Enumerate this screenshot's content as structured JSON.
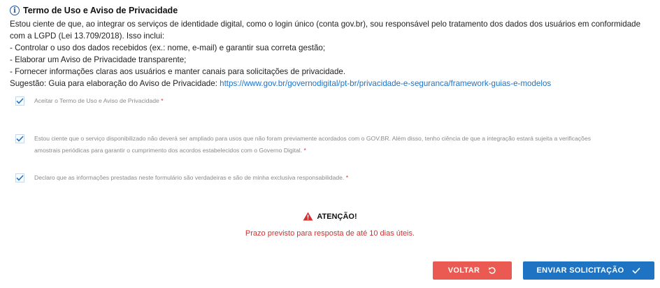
{
  "terms": {
    "title": "Termo de Uso e Aviso de Privacidade",
    "intro": "Estou ciente de que, ao integrar os serviços de identidade digital, como o login único (conta gov.br), sou responsável pelo tratamento dos dados dos usuários em conformidade com a LGPD (Lei 13.709/2018). Isso inclui:",
    "items": [
      "- Controlar o uso dos dados recebidos (ex.: nome, e-mail) e garantir sua correta gestão;",
      "- Elaborar um Aviso de Privacidade transparente;",
      "- Fornecer informações claras aos usuários e manter canais para solicitações de privacidade."
    ],
    "suggestion_label": "Sugestão: Guia para elaboração do Aviso de Privacidade: ",
    "suggestion_link": "https://www.gov.br/governodigital/pt-br/privacidade-e-seguranca/framework-guias-e-modelos"
  },
  "checkboxes": [
    {
      "label": "Aceitar o Termo de Uso e Aviso de Privacidade",
      "required": "*",
      "checked": true
    },
    {
      "label": "Estou ciente que o serviço disponibilizado não deverá ser ampliado para usos que não foram previamente acordados com o GOV.BR. Além disso, tenho ciência de que a integração estará sujeita a verificações amostrais periódicas para garantir o cumprimento dos acordos estabelecidos com o Governo Digital.",
      "required": "*",
      "checked": true
    },
    {
      "label": "Declaro que as informações prestadas neste formulário são verdadeiras e são de minha exclusiva responsabilidade.",
      "required": "*",
      "checked": true
    }
  ],
  "attention": {
    "heading": "ATENÇÃO!",
    "message": "Prazo previsto para resposta de até 10 dias úteis."
  },
  "buttons": {
    "back": "VOLTAR",
    "send": "ENVIAR SOLICITAÇÃO"
  },
  "colors": {
    "accent_blue": "#1e73c2",
    "back_red": "#ea5a52",
    "warning_red": "#d32f2f",
    "link": "#1a73c8"
  },
  "icons": {
    "info": "info-icon",
    "warning": "warning-icon",
    "undo": "undo-icon",
    "check": "check-icon"
  }
}
